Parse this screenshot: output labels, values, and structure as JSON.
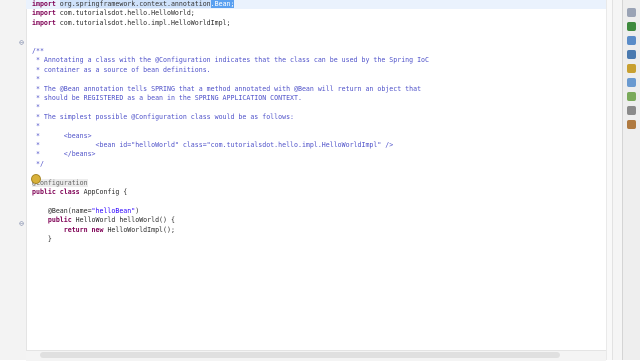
{
  "code_lines": [
    {
      "segments": [
        {
          "t": "import ",
          "c": "kw"
        },
        {
          "t": "org.springframework.context.annotation",
          "c": "sel"
        },
        {
          "t": ".Bean;",
          "c": "caretbox"
        }
      ]
    },
    {
      "segments": [
        {
          "t": "import ",
          "c": "kw"
        },
        {
          "t": "com.tutorialsdot.hello.HelloWorld;",
          "c": "plain"
        }
      ]
    },
    {
      "segments": [
        {
          "t": "import ",
          "c": "kw"
        },
        {
          "t": "com.tutorialsdot.hello.impl.HelloWorldImpl;",
          "c": "plain"
        }
      ]
    },
    {
      "segments": []
    },
    {
      "segments": []
    },
    {
      "segments": [
        {
          "t": "/**",
          "c": "cmt"
        }
      ]
    },
    {
      "segments": [
        {
          "t": " * Annotating a class with the @Configuration indicates that the class can be used by the Spring IoC",
          "c": "cmt"
        }
      ]
    },
    {
      "segments": [
        {
          "t": " * container as a source of bean definitions.",
          "c": "cmt"
        }
      ]
    },
    {
      "segments": [
        {
          "t": " *",
          "c": "cmt"
        }
      ]
    },
    {
      "segments": [
        {
          "t": " * The @Bean annotation tells SPRING that a method annotated with @Bean will return an object that",
          "c": "cmt"
        }
      ]
    },
    {
      "segments": [
        {
          "t": " * should be REGISTERED as a bean in the SPRING APPLICATION CONTEXT.",
          "c": "cmt"
        }
      ]
    },
    {
      "segments": [
        {
          "t": " *",
          "c": "cmt"
        }
      ]
    },
    {
      "segments": [
        {
          "t": " * The simplest possible @Configuration class would be as follows:",
          "c": "cmt"
        }
      ]
    },
    {
      "segments": [
        {
          "t": " *",
          "c": "cmt"
        }
      ]
    },
    {
      "segments": [
        {
          "t": " *      <beans>",
          "c": "cmt"
        }
      ]
    },
    {
      "segments": [
        {
          "t": " *              <bean id=\"helloWorld\" class=\"com.tutorialsdot.hello.impl.HelloWorldImpl\" />",
          "c": "cmt"
        }
      ]
    },
    {
      "segments": [
        {
          "t": " *      </beans>",
          "c": "cmt"
        }
      ]
    },
    {
      "segments": [
        {
          "t": " */",
          "c": "cmt"
        }
      ]
    },
    {
      "segments": []
    },
    {
      "segments": [
        {
          "t": "@Configuration",
          "c": "ann"
        }
      ]
    },
    {
      "segments": [
        {
          "t": "public class ",
          "c": "kw"
        },
        {
          "t": "AppConfig {",
          "c": "plain"
        }
      ]
    },
    {
      "segments": []
    },
    {
      "segments": [
        {
          "t": "    @Bean(name=",
          "c": "plain"
        },
        {
          "t": "\"helloBean\"",
          "c": "str"
        },
        {
          "t": ")",
          "c": "plain"
        }
      ]
    },
    {
      "segments": [
        {
          "t": "    public ",
          "c": "kw"
        },
        {
          "t": "HelloWorld helloWorld() {",
          "c": "plain"
        }
      ]
    },
    {
      "segments": [
        {
          "t": "        return new ",
          "c": "kw"
        },
        {
          "t": "HelloWorldImpl();",
          "c": "plain"
        }
      ]
    },
    {
      "segments": [
        {
          "t": "    }",
          "c": "plain"
        }
      ]
    },
    {
      "segments": []
    },
    {
      "segments": []
    }
  ],
  "colors": {
    "keyword": "#7f0055",
    "comment": "#4f52c9",
    "string": "#2a00ff",
    "selection": "#cfe2fb"
  },
  "right_toolbar": [
    {
      "name": "restore-icon",
      "color": "#9aa3b5"
    },
    {
      "name": "task-list-icon",
      "color": "#3e8a3e"
    },
    {
      "name": "outline-icon",
      "color": "#5a8cc8"
    },
    {
      "name": "console-icon",
      "color": "#4a7ab0"
    },
    {
      "name": "problems-icon",
      "color": "#c8a030"
    },
    {
      "name": "javadoc-icon",
      "color": "#6a9ad0"
    },
    {
      "name": "declaration-icon",
      "color": "#7aaa5a"
    },
    {
      "name": "search-icon",
      "color": "#8a8a8a"
    },
    {
      "name": "history-icon",
      "color": "#b07a40"
    }
  ]
}
